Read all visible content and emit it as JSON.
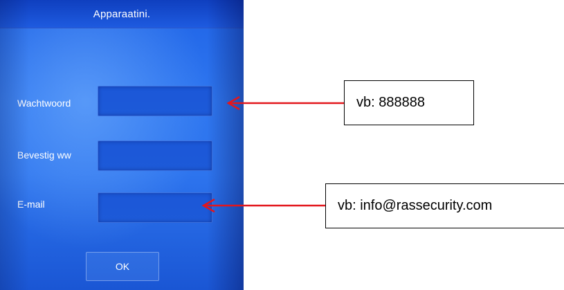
{
  "screen": {
    "title": "Apparaatini.",
    "fields": [
      {
        "label": "Wachtwoord",
        "value": ""
      },
      {
        "label": "Bevestig ww",
        "value": ""
      },
      {
        "label": "E-mail",
        "value": ""
      }
    ],
    "ok_label": "OK"
  },
  "annotations": {
    "password_example": "vb: 888888",
    "email_example": "vb: info@rassecurity.com",
    "arrow_color": "#e3161b"
  }
}
